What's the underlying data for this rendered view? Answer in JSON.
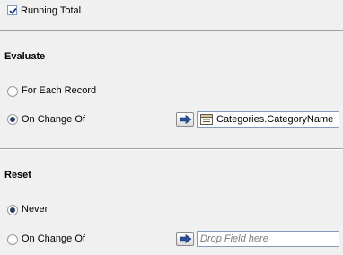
{
  "running_total": {
    "label": "Running Total",
    "checked": true
  },
  "evaluate": {
    "title": "Evaluate",
    "options": [
      {
        "label": "For Each Record",
        "selected": false
      },
      {
        "label": "On Change Of",
        "selected": true
      }
    ],
    "field_value": "Categories.CategoryName",
    "field_icon": "table-field-icon"
  },
  "reset": {
    "title": "Reset",
    "options": [
      {
        "label": "Never",
        "selected": true
      },
      {
        "label": "On Change Of",
        "selected": false
      }
    ],
    "field_placeholder": "Drop Field here"
  },
  "colors": {
    "accent": "#2a3e64",
    "border": "#7f9db9",
    "background": "#f0f0f0"
  }
}
